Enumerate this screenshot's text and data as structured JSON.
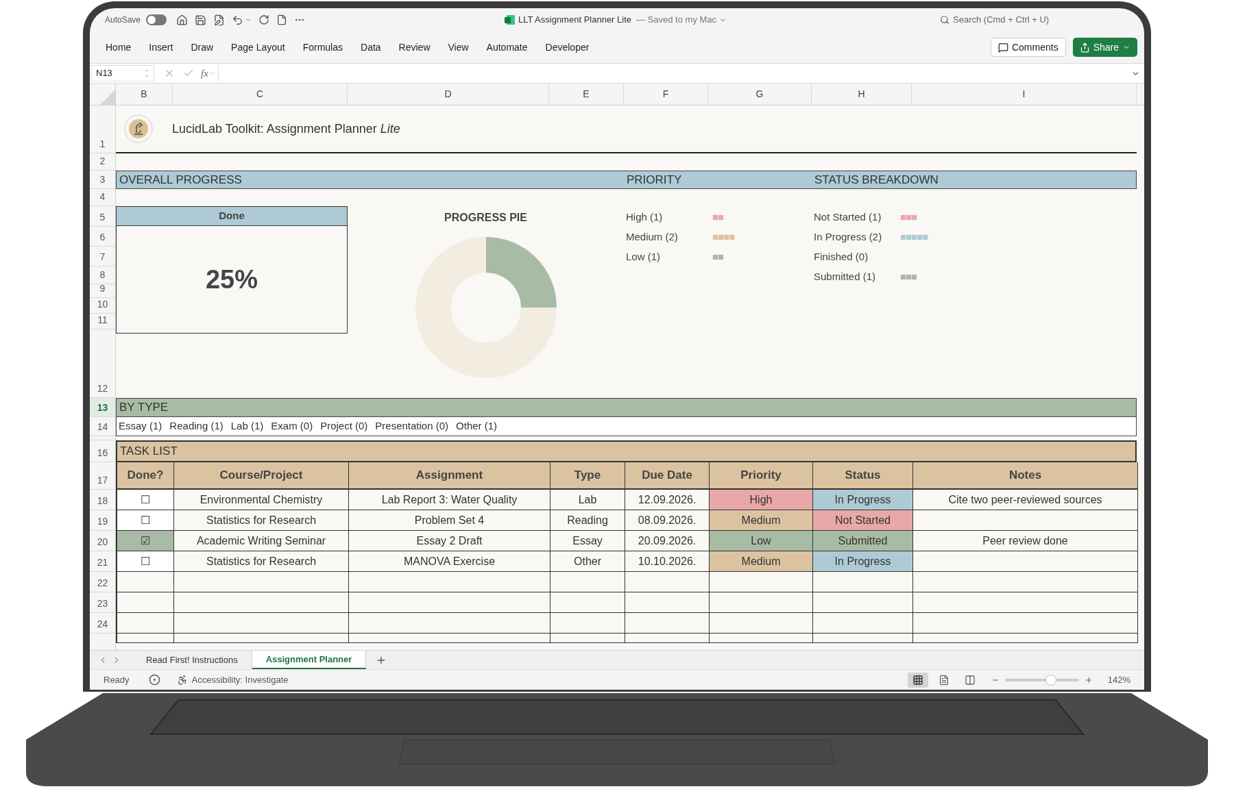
{
  "window": {
    "autosave_label": "AutoSave",
    "autosave_on": false,
    "title": "LLT Assignment Planner Lite",
    "save_status": "— Saved to my Mac",
    "search_placeholder": "Search (Cmd + Ctrl + U)"
  },
  "ribbon": {
    "tabs": [
      "Home",
      "Insert",
      "Draw",
      "Page Layout",
      "Formulas",
      "Data",
      "Review",
      "View",
      "Automate",
      "Developer"
    ],
    "comments_button": "Comments",
    "share_button": "Share"
  },
  "formula_bar": {
    "name_box": "N13",
    "fx": "fx"
  },
  "column_headers": [
    "B",
    "C",
    "D",
    "E",
    "F",
    "G",
    "H",
    "I"
  ],
  "row_numbers": [
    {
      "label": "1",
      "selected": false
    },
    {
      "label": "2",
      "selected": false
    },
    {
      "label": "3",
      "selected": false
    },
    {
      "label": "4",
      "selected": false
    },
    {
      "label": "5",
      "selected": false
    },
    {
      "label": "6",
      "selected": false
    },
    {
      "label": "7",
      "selected": false
    },
    {
      "label": "8",
      "selected": false
    },
    {
      "label": "9",
      "selected": false
    },
    {
      "label": "10",
      "selected": false
    },
    {
      "label": "11",
      "selected": false
    },
    {
      "label": "12",
      "selected": false
    },
    {
      "label": "13",
      "selected": true
    },
    {
      "label": "14",
      "selected": false
    },
    {
      "label": "16",
      "selected": false
    },
    {
      "label": "17",
      "selected": false
    },
    {
      "label": "18",
      "selected": false
    },
    {
      "label": "19",
      "selected": false
    },
    {
      "label": "20",
      "selected": false
    },
    {
      "label": "21",
      "selected": false
    },
    {
      "label": "22",
      "selected": false
    },
    {
      "label": "23",
      "selected": false
    },
    {
      "label": "24",
      "selected": false
    }
  ],
  "sheet_title": "LucidLab Toolkit: Assignment Planner *Lite*",
  "overview_band": {
    "overall": "OVERALL PROGRESS",
    "priority": "PRIORITY",
    "status": "STATUS BREAKDOWN"
  },
  "done_box": {
    "header": "Done",
    "value": "25%"
  },
  "pie": {
    "title": "PROGRESS PIE"
  },
  "priority_legend": [
    {
      "label": "High (1)",
      "bar": "■■",
      "color": "#e8a8a8"
    },
    {
      "label": "Medium (2)",
      "bar": "■■■■",
      "color": "#dcc3a0"
    },
    {
      "label": "Low (1)",
      "bar": "■■",
      "color": "#a8bba4"
    }
  ],
  "status_legend": [
    {
      "label": "Not Started (1)",
      "bar": "■■■",
      "color": "#e8a8a8"
    },
    {
      "label": "In Progress (2)",
      "bar": "■■■■■",
      "color": "#aecbd5"
    },
    {
      "label": "Finished (0)"
    },
    {
      "label": "Submitted (1)",
      "bar": "■■■",
      "color": "#a8bba4"
    }
  ],
  "by_type": {
    "title": "BY TYPE",
    "items": [
      "Essay (1)",
      "Reading (1)",
      "Lab (1)",
      "Exam (0)",
      "Project (0)",
      "Presentation (0)",
      "Other (1)"
    ]
  },
  "tasks": {
    "title": "TASK LIST",
    "columns": [
      "Done?",
      "Course/Project",
      "Assignment",
      "Type",
      "Due Date",
      "Priority",
      "Status",
      "Notes"
    ],
    "rows": [
      {
        "done": "☐",
        "checked": false,
        "course": "Environmental Chemistry",
        "assignment": "Lab Report 3: Water Quality",
        "type": "Lab",
        "due": "12.09.2026.",
        "priority": {
          "label": "High",
          "color": "#e8a8a8"
        },
        "status": {
          "label": "In Progress",
          "color": "#aecbd5"
        },
        "notes": "Cite two peer-reviewed sources"
      },
      {
        "done": "☐",
        "checked": false,
        "course": "Statistics for Research",
        "assignment": "Problem Set 4",
        "type": "Reading",
        "due": "08.09.2026.",
        "priority": {
          "label": "Medium",
          "color": "#dcc3a0"
        },
        "status": {
          "label": "Not Started",
          "color": "#e8a8a8"
        }
      },
      {
        "done": "☑",
        "checked": true,
        "course": "Academic Writing Seminar",
        "assignment": "Essay 2 Draft",
        "type": "Essay",
        "due": "20.09.2026.",
        "priority": {
          "label": "Low",
          "color": "#a8bba4"
        },
        "status": {
          "label": "Submitted",
          "color": "#a8bba4"
        },
        "notes": "Peer review done"
      },
      {
        "done": "☐",
        "checked": false,
        "course": "Statistics for Research",
        "assignment": "MANOVA Exercise",
        "type": "Other",
        "due": "10.10.2026.",
        "priority": {
          "label": "Medium",
          "color": "#dcc3a0"
        },
        "status": {
          "label": "In Progress",
          "color": "#aecbd5"
        }
      }
    ]
  },
  "sheet_tabs": [
    {
      "label": "Read First! Instructions",
      "selected": false
    },
    {
      "label": "Assignment Planner",
      "selected": true
    }
  ],
  "status_bar": {
    "ready": "Ready",
    "accessibility": "Accessibility: Investigate",
    "level": 0.62,
    "zoom": "142%",
    "views": [
      {
        "kind": "normal",
        "selected": true
      },
      {
        "kind": "page",
        "selected": false
      },
      {
        "kind": "break",
        "selected": false
      }
    ]
  }
}
